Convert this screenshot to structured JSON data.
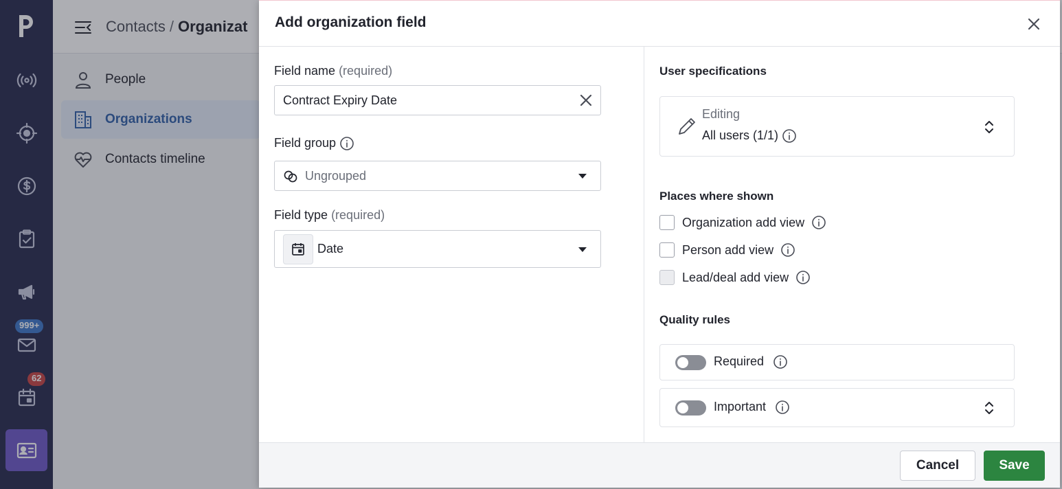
{
  "rail": {
    "badges": {
      "mail": "999+",
      "activities": "62"
    },
    "items": [
      "pipedrive-logo",
      "leads-icon",
      "deals-icon",
      "money-icon",
      "tasks-icon",
      "campaigns-icon",
      "mail-icon",
      "calendar-icon",
      "contacts-icon"
    ]
  },
  "page": {
    "breadcrumb": [
      "Contacts",
      "/",
      "Organizat"
    ],
    "subnav": [
      {
        "label": "People",
        "icon": "person-icon"
      },
      {
        "label": "Organizations",
        "icon": "building-icon",
        "active": true
      },
      {
        "label": "Contacts timeline",
        "icon": "heart-pulse-icon"
      }
    ]
  },
  "modal": {
    "title": "Add organization field",
    "field_name": {
      "label": "Field name",
      "required": "(required)",
      "value": "Contract Expiry Date"
    },
    "field_group": {
      "label": "Field group",
      "value": "Ungrouped"
    },
    "field_type": {
      "label": "Field type",
      "required": "(required)",
      "value": "Date"
    },
    "user_specs": {
      "title": "User specifications",
      "editing_label": "Editing",
      "editing_value": "All users (1/1)"
    },
    "places": {
      "title": "Places where shown",
      "options": [
        "Organization add view",
        "Person add view",
        "Lead/deal add view"
      ]
    },
    "quality": {
      "title": "Quality rules",
      "required_label": "Required",
      "important_label": "Important"
    },
    "footer": {
      "cancel": "Cancel",
      "save": "Save"
    }
  },
  "colors": {
    "rail": "#26294d",
    "rail_active": "#6d58c7",
    "save": "#2c8540",
    "subnav_active": "#2f5fa8"
  }
}
